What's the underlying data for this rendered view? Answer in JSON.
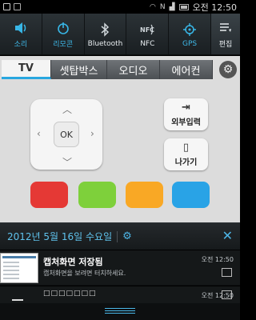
{
  "status_bar": {
    "time": "오전 12:50"
  },
  "quick_settings": {
    "items": [
      {
        "label": "소리",
        "icon": "speaker-icon"
      },
      {
        "label": "리모콘",
        "icon": "power-icon"
      },
      {
        "label": "Bluetooth",
        "icon": "bluetooth-icon"
      },
      {
        "label": "NFC",
        "icon": "nfc-icon"
      },
      {
        "label": "GPS",
        "icon": "gps-icon"
      }
    ],
    "edit_label": "편집"
  },
  "remote": {
    "tabs": [
      {
        "label": "TV"
      },
      {
        "label": "셋탑박스"
      },
      {
        "label": "오디오"
      },
      {
        "label": "에어컨"
      }
    ],
    "ok_label": "OK",
    "external_input_label": "외부입력",
    "exit_label": "나가기",
    "color_buttons": [
      "#e53935",
      "#7ed03b",
      "#f9a825",
      "#29a3e6"
    ]
  },
  "notifications": {
    "date": "2012년 5월 16일 수요일",
    "items": [
      {
        "title": "캡처화면 저장됨",
        "subtitle": "캡처화면을 보려면 터치하세요.",
        "time": "오전 12:50"
      },
      {
        "title": "□□□□□□□",
        "time": "오전 12:50"
      }
    ]
  }
}
